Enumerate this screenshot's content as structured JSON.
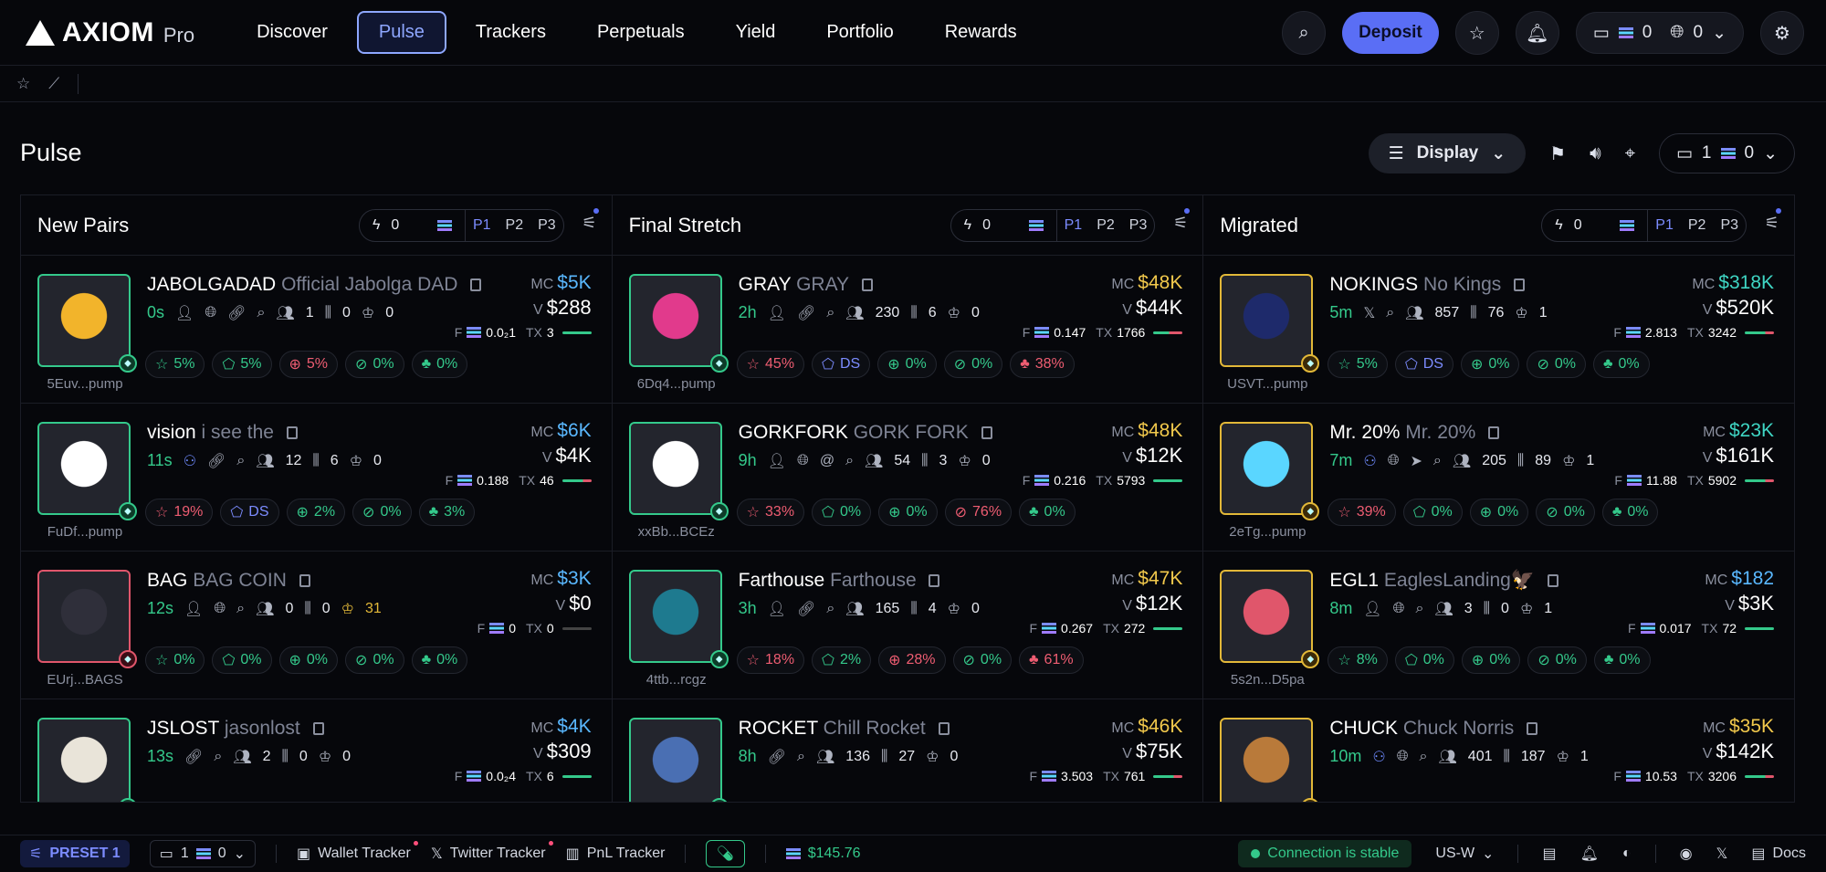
{
  "app": {
    "logo": "AXIOM",
    "logo_sub": "Pro"
  },
  "nav": [
    "Discover",
    "Pulse",
    "Trackers",
    "Perpetuals",
    "Yield",
    "Portfolio",
    "Rewards"
  ],
  "top": {
    "deposit": "Deposit",
    "wallet_sol": "0",
    "wallet_usd": "0"
  },
  "page": {
    "title": "Pulse",
    "display": "Display",
    "wallet_count": "1",
    "wallet_bal": "0"
  },
  "columns": [
    {
      "title": "New Pairs",
      "amount": "0",
      "presets": [
        "P1",
        "P2",
        "P3"
      ],
      "cards": [
        {
          "ticker": "JABOLGADAD",
          "name": "Official Jabolga DAD",
          "addr": "5Euv...pump",
          "age": "0s",
          "icons": [
            "user",
            "globe",
            "link",
            "search"
          ],
          "holders": "1",
          "snipers": "0",
          "top10": "0",
          "crown_gold": false,
          "mc": "$5K",
          "mc_color": "blue",
          "vol": "$288",
          "f": "0.0₂1",
          "tx": "3",
          "bar": "",
          "border": "",
          "pills": [
            [
              "g",
              "5%"
            ],
            [
              "g",
              "5%"
            ],
            [
              "r",
              "5%"
            ],
            [
              "g",
              "0%"
            ],
            [
              "g",
              "0%"
            ]
          ]
        },
        {
          "ticker": "vision",
          "name": "i see the",
          "addr": "FuDf...pump",
          "age": "11s",
          "icons": [
            "users",
            "link",
            "search"
          ],
          "holders": "12",
          "snipers": "6",
          "top10": "0",
          "crown_gold": false,
          "mc": "$6K",
          "mc_color": "blue",
          "vol": "$4K",
          "f": "0.188",
          "tx": "46",
          "bar": "mix",
          "border": "",
          "pills": [
            [
              "r",
              "19%"
            ],
            [
              "b",
              "DS"
            ],
            [
              "g",
              "2%"
            ],
            [
              "g",
              "0%"
            ],
            [
              "g",
              "3%"
            ]
          ]
        },
        {
          "ticker": "BAG",
          "name": "BAG COIN",
          "addr": "EUrj...BAGS",
          "age": "12s",
          "icons": [
            "user",
            "globe",
            "search"
          ],
          "holders": "0",
          "snipers": "0",
          "top10": "31",
          "crown_gold": true,
          "mc": "$3K",
          "mc_color": "blue",
          "vol": "$0",
          "f": "0",
          "tx": "0",
          "bar": "grey",
          "border": "red",
          "pills": [
            [
              "g",
              "0%"
            ],
            [
              "g",
              "0%"
            ],
            [
              "g",
              "0%"
            ],
            [
              "g",
              "0%"
            ],
            [
              "g",
              "0%"
            ]
          ]
        },
        {
          "ticker": "JSLOST",
          "name": "jasonlost",
          "addr": "",
          "age": "13s",
          "icons": [
            "link",
            "search"
          ],
          "holders": "2",
          "snipers": "0",
          "top10": "0",
          "crown_gold": false,
          "mc": "$4K",
          "mc_color": "blue",
          "vol": "$309",
          "f": "0.0₂4",
          "tx": "6",
          "bar": "",
          "border": "",
          "pills": []
        }
      ]
    },
    {
      "title": "Final Stretch",
      "amount": "0",
      "presets": [
        "P1",
        "P2",
        "P3"
      ],
      "cards": [
        {
          "ticker": "GRAY",
          "name": "GRAY",
          "addr": "6Dq4...pump",
          "age": "2h",
          "icons": [
            "user",
            "link",
            "search"
          ],
          "holders": "230",
          "snipers": "6",
          "top10": "0",
          "crown_gold": false,
          "mc": "$48K",
          "mc_color": "yellow",
          "vol": "$44K",
          "f": "0.147",
          "tx": "1766",
          "bar": "mix2",
          "border": "",
          "pills": [
            [
              "r",
              "45%"
            ],
            [
              "b",
              "DS"
            ],
            [
              "g",
              "0%"
            ],
            [
              "g",
              "0%"
            ],
            [
              "r",
              "38%"
            ]
          ]
        },
        {
          "ticker": "GORKFORK",
          "name": "GORK FORK",
          "addr": "xxBb...BCEz",
          "age": "9h",
          "icons": [
            "user",
            "globe",
            "at",
            "search"
          ],
          "holders": "54",
          "snipers": "3",
          "top10": "0",
          "crown_gold": false,
          "mc": "$48K",
          "mc_color": "yellow",
          "vol": "$12K",
          "f": "0.216",
          "tx": "5793",
          "bar": "",
          "border": "",
          "pills": [
            [
              "r",
              "33%"
            ],
            [
              "g",
              "0%"
            ],
            [
              "g",
              "0%"
            ],
            [
              "r",
              "76%"
            ],
            [
              "g",
              "0%"
            ]
          ]
        },
        {
          "ticker": "Farthouse",
          "name": "Farthouse",
          "addr": "4ttb...rcgz",
          "age": "3h",
          "icons": [
            "user",
            "link",
            "search"
          ],
          "holders": "165",
          "snipers": "4",
          "top10": "0",
          "crown_gold": false,
          "mc": "$47K",
          "mc_color": "yellow",
          "vol": "$12K",
          "f": "0.267",
          "tx": "272",
          "bar": "",
          "border": "",
          "pills": [
            [
              "r",
              "18%"
            ],
            [
              "g",
              "2%"
            ],
            [
              "r",
              "28%"
            ],
            [
              "g",
              "0%"
            ],
            [
              "r",
              "61%"
            ]
          ]
        },
        {
          "ticker": "ROCKET",
          "name": "Chill Rocket",
          "addr": "",
          "age": "8h",
          "icons": [
            "link",
            "search"
          ],
          "holders": "136",
          "snipers": "27",
          "top10": "0",
          "crown_gold": false,
          "mc": "$46K",
          "mc_color": "yellow",
          "vol": "$75K",
          "f": "3.503",
          "tx": "761",
          "bar": "mix",
          "border": "",
          "pills": []
        }
      ]
    },
    {
      "title": "Migrated",
      "amount": "0",
      "presets": [
        "P1",
        "P2",
        "P3"
      ],
      "cards": [
        {
          "ticker": "NOKINGS",
          "name": "No Kings",
          "addr": "USVT...pump",
          "age": "5m",
          "icons": [
            "x",
            "search"
          ],
          "holders": "857",
          "snipers": "76",
          "top10": "1",
          "crown_gold": false,
          "mc": "$318K",
          "mc_color": "teal",
          "vol": "$520K",
          "f": "2.813",
          "tx": "3242",
          "bar": "mix",
          "border": "gold",
          "pills": [
            [
              "g",
              "5%"
            ],
            [
              "b",
              "DS"
            ],
            [
              "g",
              "0%"
            ],
            [
              "g",
              "0%"
            ],
            [
              "g",
              "0%"
            ]
          ]
        },
        {
          "ticker": "Mr. 20%",
          "name": "Mr. 20%",
          "addr": "2eTg...pump",
          "age": "7m",
          "icons": [
            "users",
            "globe",
            "send",
            "search"
          ],
          "holders": "205",
          "snipers": "89",
          "top10": "1",
          "crown_gold": false,
          "mc": "$23K",
          "mc_color": "teal",
          "vol": "$161K",
          "f": "11.88",
          "tx": "5902",
          "bar": "mix",
          "border": "gold",
          "pills": [
            [
              "r",
              "39%"
            ],
            [
              "g",
              "0%"
            ],
            [
              "g",
              "0%"
            ],
            [
              "g",
              "0%"
            ],
            [
              "g",
              "0%"
            ]
          ]
        },
        {
          "ticker": "EGL1",
          "name": "EaglesLanding🦅",
          "addr": "5s2n...D5pa",
          "age": "8m",
          "icons": [
            "user",
            "globe",
            "search"
          ],
          "holders": "3",
          "snipers": "0",
          "top10": "1",
          "crown_gold": false,
          "mc": "$182",
          "mc_color": "blue",
          "vol": "$3K",
          "f": "0.017",
          "tx": "72",
          "bar": "",
          "border": "gold",
          "pills": [
            [
              "g",
              "8%"
            ],
            [
              "g",
              "0%"
            ],
            [
              "g",
              "0%"
            ],
            [
              "g",
              "0%"
            ],
            [
              "g",
              "0%"
            ]
          ]
        },
        {
          "ticker": "CHUCK",
          "name": "Chuck Norris",
          "addr": "",
          "age": "10m",
          "icons": [
            "users",
            "globe",
            "search"
          ],
          "holders": "401",
          "snipers": "187",
          "top10": "1",
          "crown_gold": false,
          "mc": "$35K",
          "mc_color": "yellow",
          "vol": "$142K",
          "f": "10.53",
          "tx": "3206",
          "bar": "mix",
          "border": "gold",
          "pills": []
        }
      ]
    }
  ],
  "labels": {
    "mc": "MC",
    "v": "V",
    "f": "F",
    "tx": "TX"
  },
  "footer": {
    "preset": "PRESET 1",
    "wallets": "1",
    "bal": "0",
    "wallet_tracker": "Wallet Tracker",
    "twitter_tracker": "Twitter Tracker",
    "pnl_tracker": "PnL Tracker",
    "pnl": "$145.76",
    "conn": "Connection is stable",
    "region": "US-W",
    "docs": "Docs"
  },
  "colors": {
    "accent": "#5a6ef5",
    "green": "#34c98b",
    "red": "#ef5d72",
    "gold": "#e2b838"
  }
}
